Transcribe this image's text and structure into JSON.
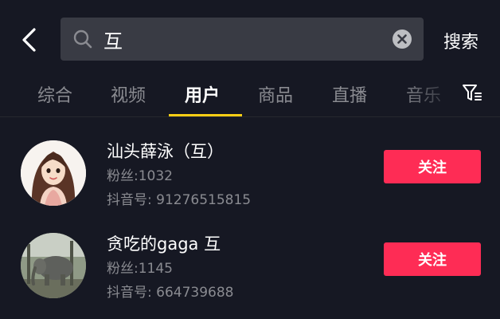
{
  "search": {
    "value": "互",
    "submit_label": "搜索"
  },
  "tabs": [
    {
      "label": "综合",
      "active": false
    },
    {
      "label": "视频",
      "active": false
    },
    {
      "label": "用户",
      "active": true
    },
    {
      "label": "商品",
      "active": false
    },
    {
      "label": "直播",
      "active": false
    },
    {
      "label": "音乐",
      "active": false
    }
  ],
  "users": [
    {
      "name": "汕头薛泳（互）",
      "fans": "粉丝:1032",
      "douyin_id": "抖音号: 91276515815",
      "follow_label": "关注"
    },
    {
      "name": "贪吃的gaga   互",
      "fans": "粉丝:1145",
      "douyin_id": "抖音号: 664739688",
      "follow_label": "关注"
    }
  ],
  "colors": {
    "background": "#161823",
    "search_box": "#393b44",
    "accent_tab": "#face15",
    "follow_button": "#fe2c55",
    "muted_text": "#8a8b91"
  },
  "icons": {
    "back": "back-chevron-icon",
    "search": "search-icon",
    "clear": "clear-icon",
    "filter": "filter-icon"
  }
}
